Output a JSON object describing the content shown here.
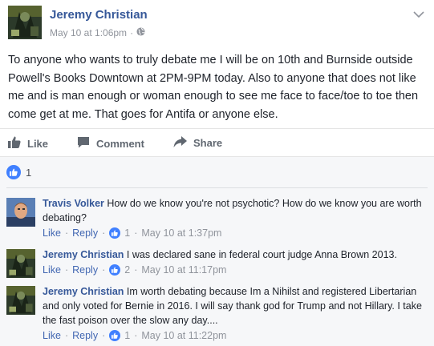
{
  "post": {
    "author": "Jeremy Christian",
    "timestamp": "May 10 at 1:06pm",
    "privacy_icon": "globe-icon",
    "text": "To anyone who wants to truly debate me I will be on 10th and Burnside outside Powell's Books Downtown at 2PM-9PM today. Also to anyone that does not like me and is man enough or woman enough to see me face to face/toe to toe then come get at me. That goes for Antifa or anyone else."
  },
  "actions": {
    "like": "Like",
    "comment": "Comment",
    "share": "Share"
  },
  "reactions": {
    "count": "1"
  },
  "comments": [
    {
      "author": "Travis Volker",
      "text": "How do we know you're not psychotic? How do we know you are worth debating?",
      "like": "Like",
      "reply": "Reply",
      "likes": "1",
      "time": "May 10 at 1:37pm"
    },
    {
      "author": "Jeremy Christian",
      "text": "I was declared sane in federal court judge Anna Brown 2013.",
      "like": "Like",
      "reply": "Reply",
      "likes": "2",
      "time": "May 10 at 11:17pm"
    },
    {
      "author": "Jeremy Christian",
      "text": "Im worth debating because Im a Nihilst and registered Libertarian and only voted for Bernie in 2016. I will say thank god for Trump and not Hillary. I take the fast poison over the slow any day....",
      "like": "Like",
      "reply": "Reply",
      "likes": "1",
      "time": "May 10 at 11:22pm"
    }
  ],
  "separator": "·",
  "colors": {
    "link": "#365899",
    "like_blue": "#4080ff",
    "meta_gray": "#90949c"
  }
}
